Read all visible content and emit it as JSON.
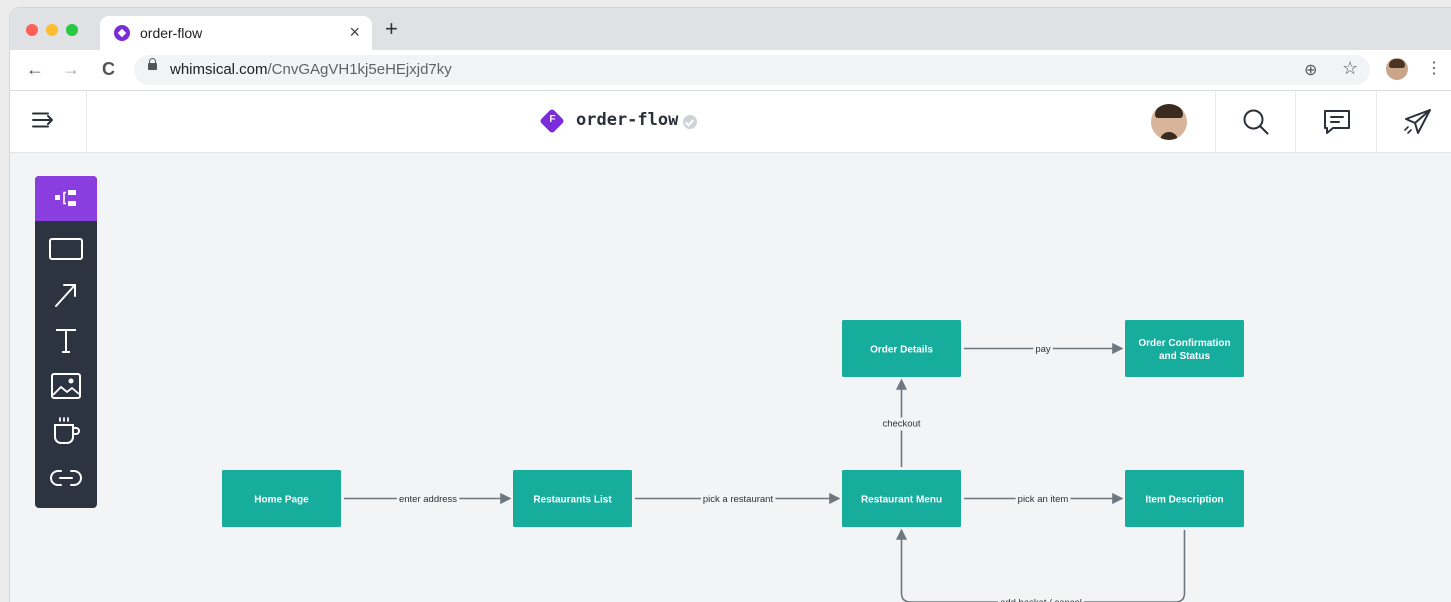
{
  "browser": {
    "tab_title": "order-flow",
    "tab_close": "×",
    "new_tab": "+",
    "back": "←",
    "forward": "→",
    "reload": "C",
    "url_host": "whimsical.com",
    "url_path": "/CnvGAgVH1kj5eHEjxjd7ky",
    "zoom_icon": "⊕",
    "star_icon": "☆",
    "kebab_icon": "⋮",
    "traffic_colors": [
      "#fe5f57",
      "#febc2e",
      "#28c840"
    ]
  },
  "app": {
    "file_badge": "F",
    "doc_title": "order-flow",
    "accent": "#7b2cd9"
  },
  "palette": {
    "items": [
      "flowchart-icon",
      "rectangle-icon",
      "arrow-icon",
      "text-icon",
      "image-icon",
      "coffee-icon",
      "link-icon"
    ],
    "active": "flowchart-icon"
  },
  "flow": {
    "node_color": "#16ad9d",
    "edge_color": "#6e7681",
    "nodes": [
      {
        "id": "home",
        "label": [
          "Home Page"
        ]
      },
      {
        "id": "restaurants",
        "label": [
          "Restaurants List"
        ]
      },
      {
        "id": "menu",
        "label": [
          "Restaurant Menu"
        ]
      },
      {
        "id": "item",
        "label": [
          "Item Description"
        ]
      },
      {
        "id": "details",
        "label": [
          "Order Details"
        ]
      },
      {
        "id": "confirm",
        "label": [
          "Order Confirmation",
          "and Status"
        ]
      }
    ],
    "edges": [
      {
        "from": "home",
        "to": "restaurants",
        "label": "enter address"
      },
      {
        "from": "restaurants",
        "to": "menu",
        "label": "pick a restaurant"
      },
      {
        "from": "menu",
        "to": "item",
        "label": "pick an item"
      },
      {
        "from": "menu",
        "to": "details",
        "label": "checkout"
      },
      {
        "from": "details",
        "to": "confirm",
        "label": "pay"
      },
      {
        "from": "item",
        "to": "menu",
        "label": "add basket / cancel"
      }
    ]
  }
}
